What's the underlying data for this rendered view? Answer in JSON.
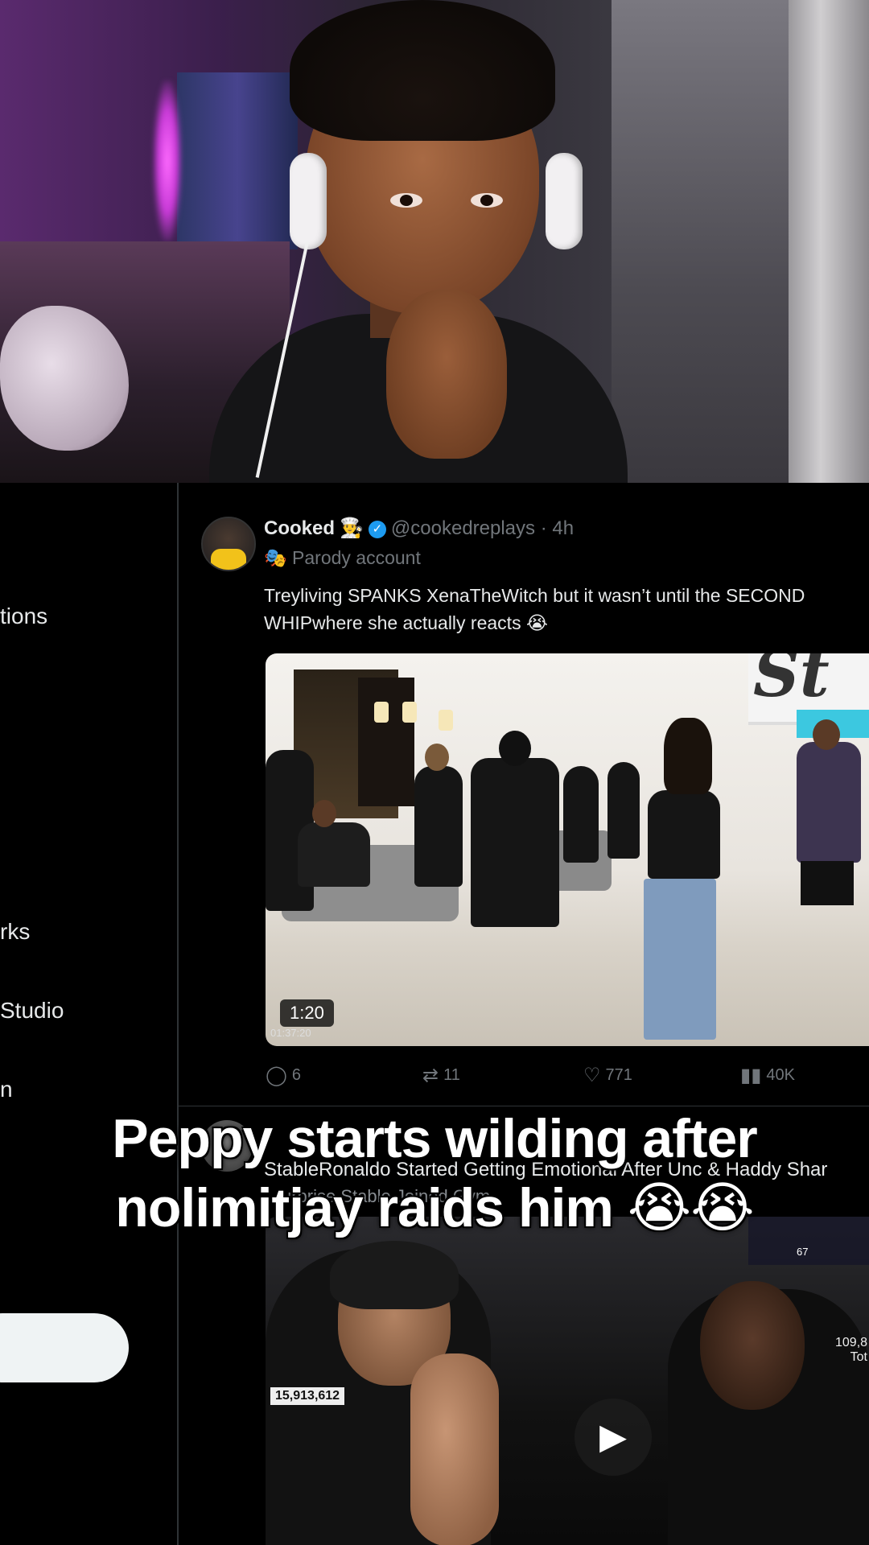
{
  "sidebar": {
    "items": [
      "tions",
      "rks",
      "Studio",
      "n"
    ]
  },
  "tweet1": {
    "name": "Cooked",
    "name_emoji": "👨‍🍳",
    "handle": "@cookedreplays",
    "time": "· 4h",
    "parody_label": "Parody account",
    "parody_icon": "🎭",
    "text": "Treyliving SPANKS XenaTheWitch but it wasn’t until the SECOND WHIPwhere she actually reacts 😭",
    "media": {
      "duration": "1:20",
      "timestamp": "01:37:20",
      "sign_text": "St"
    },
    "actions": {
      "replies": "6",
      "reposts": "11",
      "likes": "771",
      "views": "40K"
    }
  },
  "tweet2": {
    "text": "StableRonaldo Started Getting Emotional After Unc & Haddy Shar",
    "subtext": "…urprise Stable Joined Gym",
    "media": {
      "counter": "15,913,612",
      "side_value": "109,8",
      "side_label": "Tot",
      "overlay_value": "67"
    }
  },
  "caption": {
    "line1": "Peppy starts wilding after",
    "line2": "nolimitjay raids him 😭😭"
  },
  "colors": {
    "background": "#000000",
    "text": "#e7e9ea",
    "muted": "#71767b",
    "verified": "#1d9bf0"
  },
  "icons": [
    "chef-emoji",
    "verified-badge-icon",
    "parody-mask-icon",
    "reply-icon",
    "repost-icon",
    "like-icon",
    "views-icon",
    "play-icon"
  ]
}
